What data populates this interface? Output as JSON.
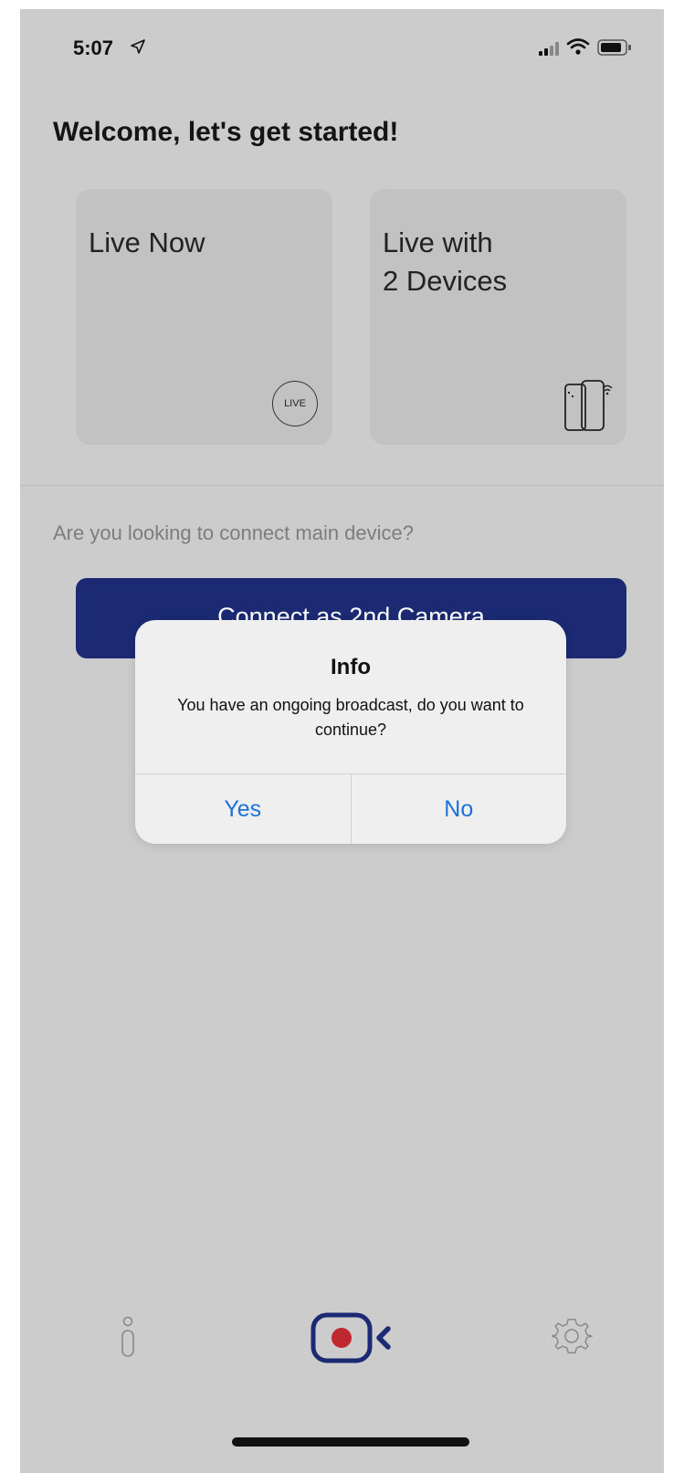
{
  "status_bar": {
    "time": "5:07",
    "icons": [
      "location-arrow-icon",
      "cellular-signal-icon",
      "wifi-icon",
      "battery-icon"
    ]
  },
  "welcome": {
    "title": "Welcome, let's get started!"
  },
  "cards": [
    {
      "label": "Live Now",
      "icon": "live-badge-icon",
      "badge_text": "LIVE"
    },
    {
      "label": "Live with\n2 Devices",
      "icon": "two-devices-wireless-icon"
    }
  ],
  "connect": {
    "question": "Are you looking to connect main device?",
    "button_label": "Connect as 2nd Camera"
  },
  "alert": {
    "title": "Info",
    "message": "You have an ongoing broadcast, do you want to continue?",
    "yes_label": "Yes",
    "no_label": "No"
  },
  "tab_bar": {
    "items": [
      "info-icon",
      "record-camera-icon",
      "settings-gear-icon"
    ]
  },
  "colors": {
    "accent": "#1b2a72",
    "alert_button": "#1a73d9",
    "record_dot": "#c0282f",
    "background": "#cccccc"
  }
}
